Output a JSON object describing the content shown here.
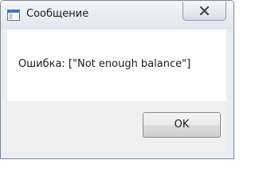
{
  "window": {
    "title": "Сообщение",
    "app_icon": "window-app-icon",
    "close_icon": "close-icon"
  },
  "dialog": {
    "message": "Ошибка: [\"Not enough balance\"]",
    "ok_label": "OK"
  },
  "colors": {
    "frame": "#e9eef4",
    "content_bg": "#ffffff",
    "footer_bg": "#f0f0f0",
    "border": "#7a8796"
  }
}
